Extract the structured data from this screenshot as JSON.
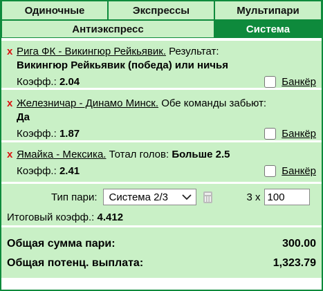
{
  "tabs_row1": [
    {
      "label": "Одиночные"
    },
    {
      "label": "Экспрессы"
    },
    {
      "label": "Мультипари"
    }
  ],
  "tabs_row2": [
    {
      "label": "Антиэкспресс"
    },
    {
      "label": "Система"
    }
  ],
  "active_tab": "Система",
  "slips": [
    {
      "remove": "x",
      "event": "Рига ФК - Викингюр Рейкьявик.",
      "market": "Результат:",
      "outcome": "Викингюр Рейкьявик (победа) или ничья",
      "coef_label": "Коэфф.:",
      "coef": "2.04",
      "banker_label": "Банкёр"
    },
    {
      "remove": "x",
      "event": "Железничар - Динамо Минск.",
      "market": "Обе команды забьют:",
      "outcome": "Да",
      "coef_label": "Коэфф.:",
      "coef": "1.87",
      "banker_label": "Банкёр"
    },
    {
      "remove": "x",
      "event": "Ямайка - Мексика.",
      "market": "Тотал голов:",
      "outcome": "Больше 2.5",
      "coef_label": "Коэфф.:",
      "coef": "2.41",
      "banker_label": "Банкёр"
    }
  ],
  "system": {
    "type_label": "Тип пари:",
    "type_value": "Система 2/3",
    "multiplier": "3 x",
    "stake": "100",
    "total_coef_label": "Итоговый коэфф.:",
    "total_coef": "4.412"
  },
  "summary": {
    "total_stake_label": "Общая сумма пари:",
    "total_stake": "300.00",
    "potential_label": "Общая потенц. выплата:",
    "potential": "1,323.79"
  },
  "colors": {
    "accent": "#0e8a3c",
    "panel": "#c9f0c6",
    "remove": "#dd1111"
  },
  "icons": [
    "remove-icon",
    "chevron-down-icon",
    "calculator-icon",
    "checkbox-icon"
  ]
}
